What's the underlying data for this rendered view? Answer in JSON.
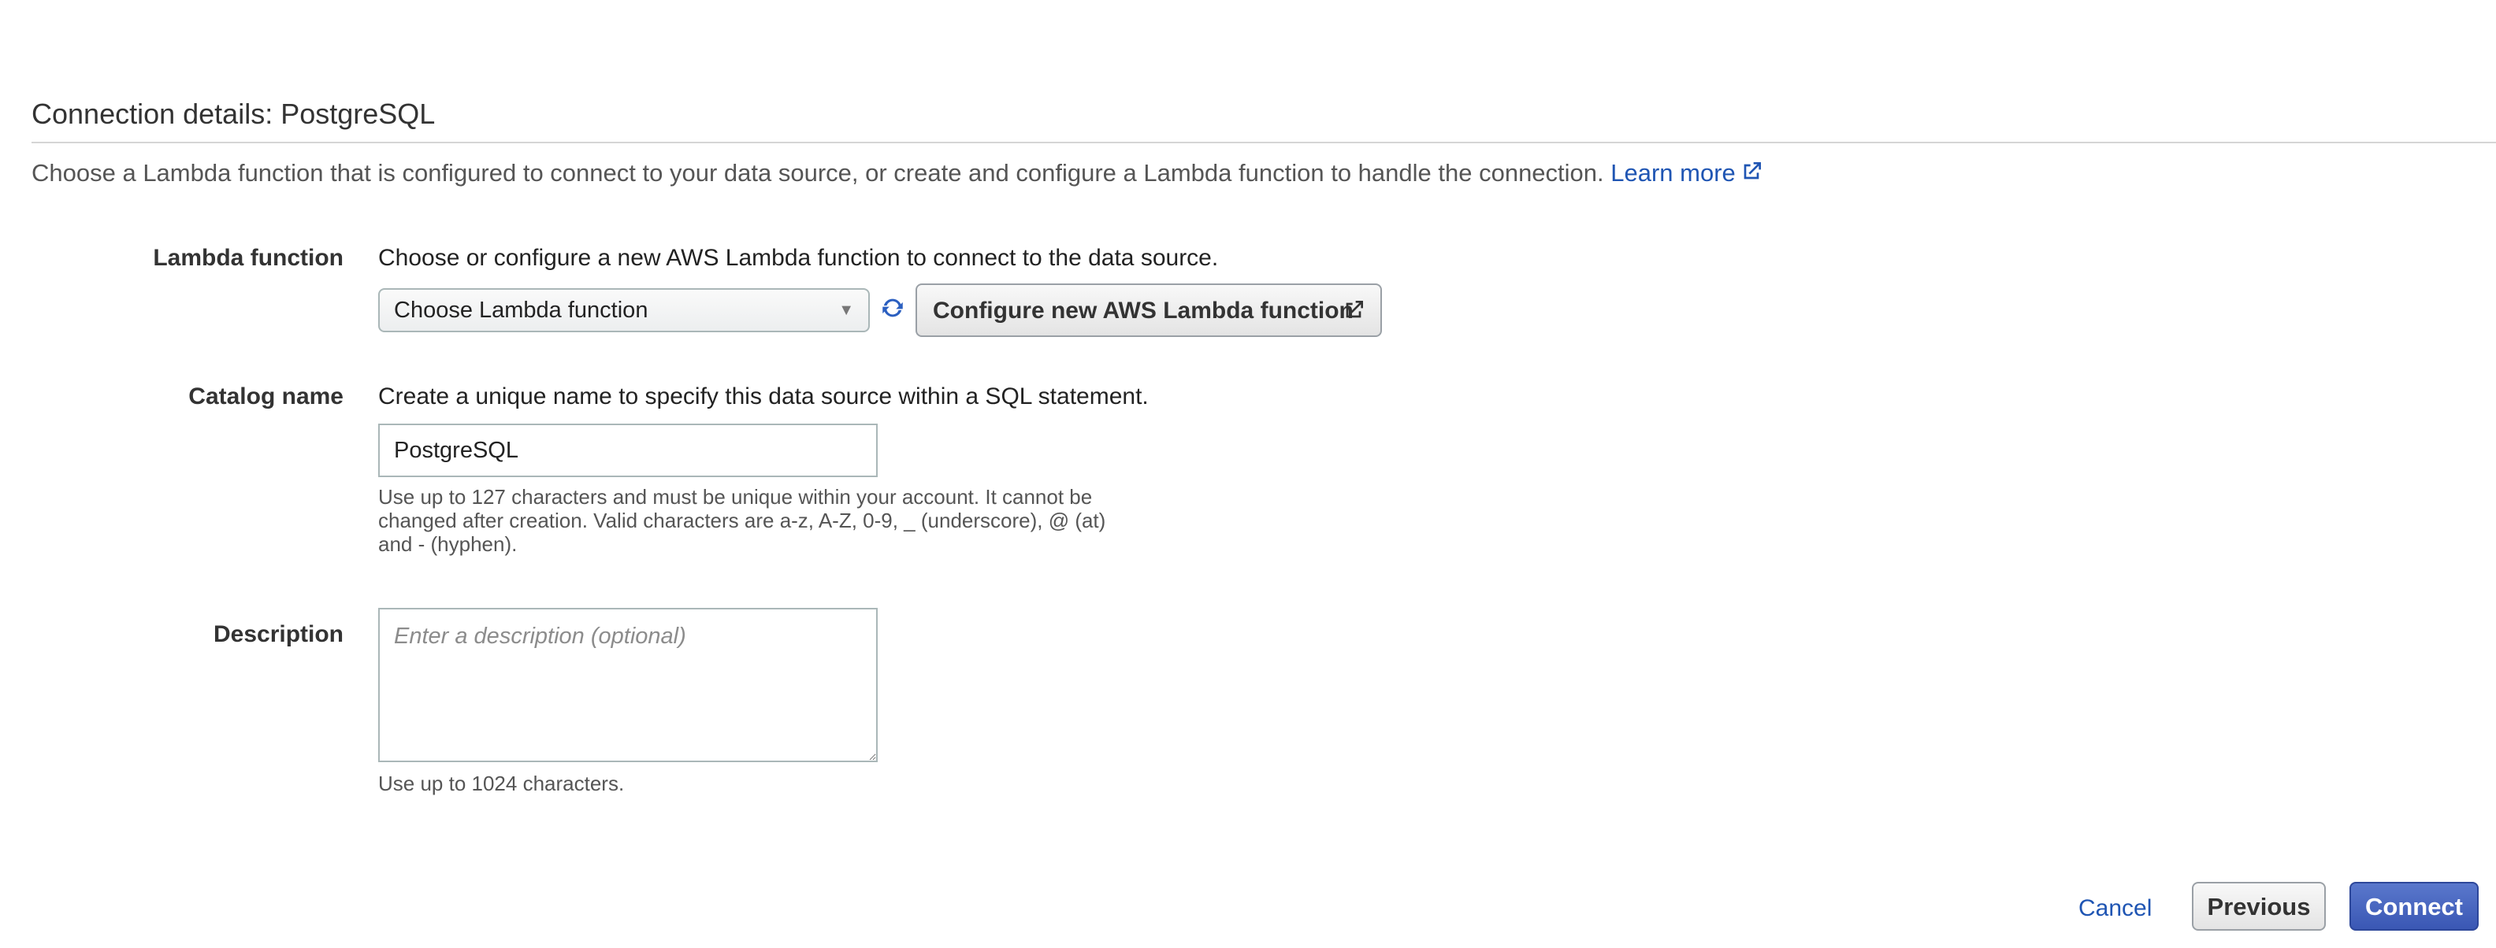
{
  "section": {
    "title": "Connection details: PostgreSQL",
    "intro": "Choose a Lambda function that is configured to connect to your data source, or create and configure a Lambda function to handle the connection. ",
    "learn_more": "Learn more"
  },
  "lambda_function": {
    "label": "Lambda function",
    "help": "Choose or configure a new AWS Lambda function to connect to the data source.",
    "select_value": "Choose Lambda function",
    "configure_button": "Configure new AWS Lambda function"
  },
  "catalog_name": {
    "label": "Catalog name",
    "help": "Create a unique name to specify this data source within a SQL statement.",
    "value": "PostgreSQL",
    "hint_lines": [
      "Use up to 127 characters and must be unique within your account. It cannot be",
      "changed after creation. Valid characters are a-z, A-Z, 0-9, _ (underscore), @ (at)",
      "and - (hyphen)."
    ]
  },
  "description": {
    "label": "Description",
    "placeholder": "Enter a description (optional)",
    "hint": "Use up to 1024 characters."
  },
  "footer": {
    "cancel": "Cancel",
    "previous": "Previous",
    "connect": "Connect"
  },
  "colors": {
    "link": "#1f55b3",
    "primary_button": "#3a57b4"
  },
  "icons": {
    "external_link": "external-link-icon",
    "refresh": "refresh-icon",
    "dropdown": "caret-down-icon"
  }
}
